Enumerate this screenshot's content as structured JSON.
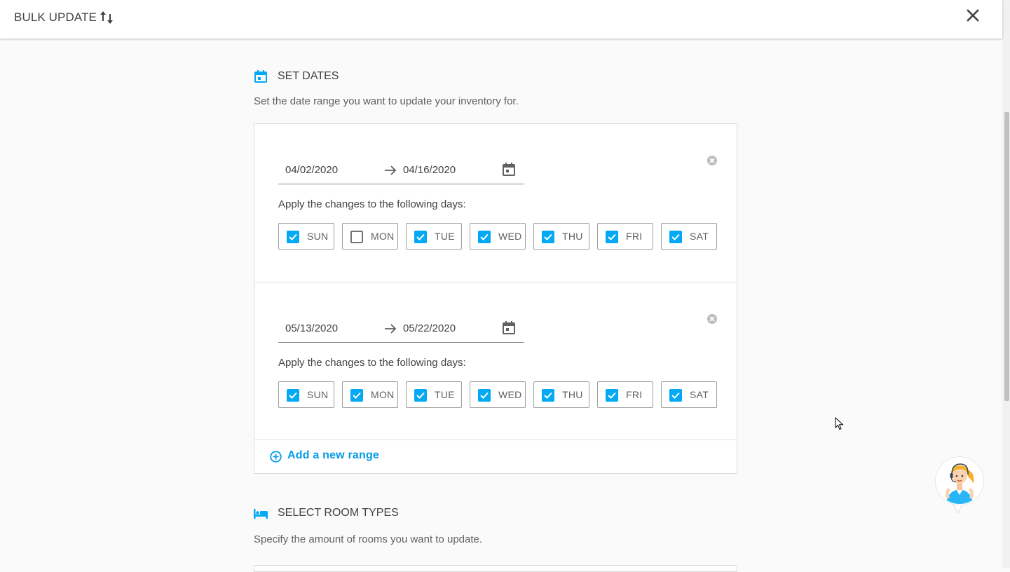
{
  "header": {
    "title": "BULK UPDATE",
    "sort_icon": "swap-vertical-icon",
    "close_icon": "close-icon"
  },
  "set_dates": {
    "icon": "calendar-icon",
    "title": "SET DATES",
    "description": "Set the date range you want to update your inventory for.",
    "ranges": [
      {
        "start": "04/02/2020",
        "end": "04/16/2020",
        "apply_label": "Apply the changes to the following days:",
        "days": [
          {
            "label": "SUN",
            "checked": true
          },
          {
            "label": "MON",
            "checked": false
          },
          {
            "label": "TUE",
            "checked": true
          },
          {
            "label": "WED",
            "checked": true
          },
          {
            "label": "THU",
            "checked": true
          },
          {
            "label": "FRI",
            "checked": true
          },
          {
            "label": "SAT",
            "checked": true
          }
        ]
      },
      {
        "start": "05/13/2020",
        "end": "05/22/2020",
        "apply_label": "Apply the changes to the following days:",
        "days": [
          {
            "label": "SUN",
            "checked": true
          },
          {
            "label": "MON",
            "checked": true
          },
          {
            "label": "TUE",
            "checked": true
          },
          {
            "label": "WED",
            "checked": true
          },
          {
            "label": "THU",
            "checked": true
          },
          {
            "label": "FRI",
            "checked": true
          },
          {
            "label": "SAT",
            "checked": true
          }
        ]
      }
    ],
    "add_range_label": "Add a new range"
  },
  "room_types": {
    "icon": "bed-icon",
    "title": "SELECT ROOM TYPES",
    "description": "Specify the amount of rooms you want to update."
  },
  "colors": {
    "accent": "#03a9f4",
    "link": "#039be5",
    "text": "#424242"
  }
}
